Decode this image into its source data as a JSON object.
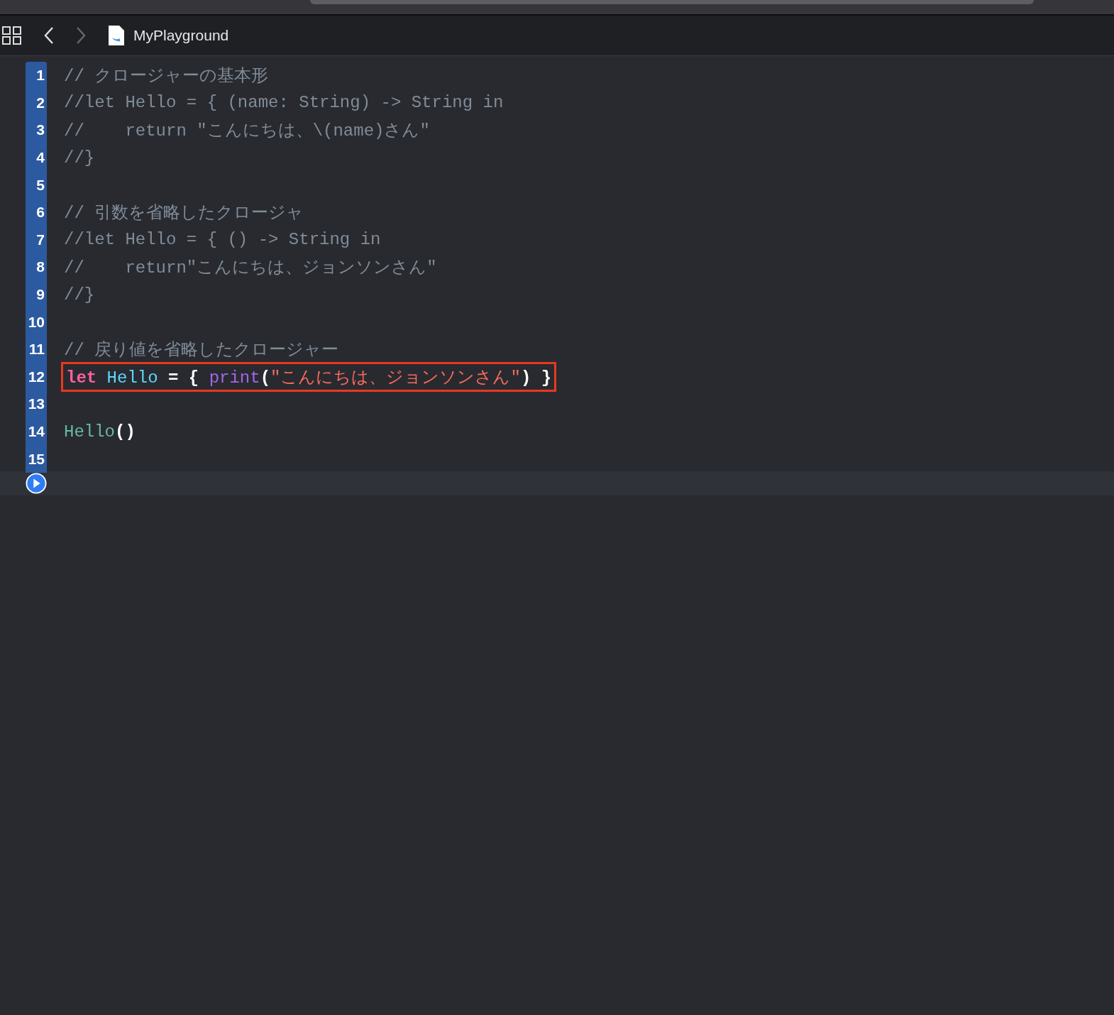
{
  "toolbar": {
    "title": "MyPlayground"
  },
  "lines": [
    {
      "number": "1",
      "highlighted": false,
      "tokens": [
        {
          "kind": "comment",
          "text": "// クロージャーの基本形"
        }
      ]
    },
    {
      "number": "2",
      "highlighted": false,
      "tokens": [
        {
          "kind": "comment",
          "text": "//let Hello = { (name: String) -> String in"
        }
      ]
    },
    {
      "number": "3",
      "highlighted": false,
      "tokens": [
        {
          "kind": "comment",
          "text": "//    return \"こんにちは、\\(name)さん\""
        }
      ]
    },
    {
      "number": "4",
      "highlighted": false,
      "tokens": [
        {
          "kind": "comment",
          "text": "//}"
        }
      ]
    },
    {
      "number": "5",
      "highlighted": false
    },
    {
      "number": "6",
      "highlighted": false,
      "tokens": [
        {
          "kind": "comment",
          "text": "// 引数を省略したクロージャ"
        }
      ]
    },
    {
      "number": "7",
      "highlighted": false,
      "tokens": [
        {
          "kind": "comment",
          "text": "//let Hello = { () -> String in"
        }
      ]
    },
    {
      "number": "8",
      "highlighted": false,
      "tokens": [
        {
          "kind": "comment",
          "text": "//    return\"こんにちは、ジョンソンさん\""
        }
      ]
    },
    {
      "number": "9",
      "highlighted": false,
      "tokens": [
        {
          "kind": "comment",
          "text": "//}"
        }
      ]
    },
    {
      "number": "10",
      "highlighted": false
    },
    {
      "number": "11",
      "highlighted": false,
      "tokens": [
        {
          "kind": "comment",
          "text": "// 戻り値を省略したクロージャー"
        }
      ]
    },
    {
      "number": "12",
      "highlighted": true,
      "tokens": [
        {
          "kind": "keyword",
          "text": "let "
        },
        {
          "kind": "declaration",
          "text": "Hello"
        },
        {
          "kind": "plain",
          "text": " = { "
        },
        {
          "kind": "function",
          "text": "print"
        },
        {
          "kind": "plain",
          "text": "("
        },
        {
          "kind": "string",
          "text": "\"こんにちは、ジョンソンさん\""
        },
        {
          "kind": "plain",
          "text": ") }"
        }
      ]
    },
    {
      "number": "13",
      "highlighted": false
    },
    {
      "number": "14",
      "highlighted": false,
      "tokens": [
        {
          "kind": "call",
          "text": "Hello"
        },
        {
          "kind": "plain",
          "text": "()"
        }
      ]
    },
    {
      "number": "15",
      "highlighted": false
    }
  ]
}
